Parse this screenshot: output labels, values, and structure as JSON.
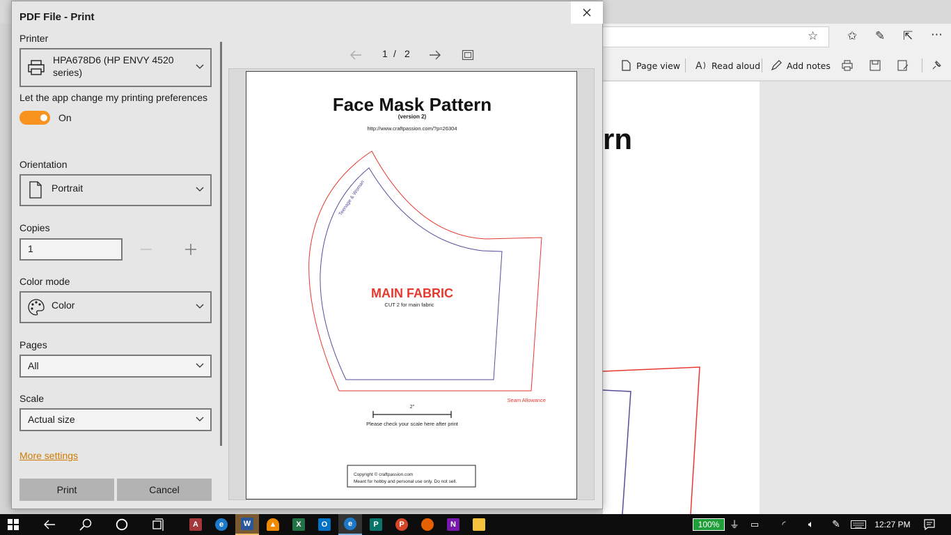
{
  "dialog": {
    "title": "PDF File - Print"
  },
  "printer": {
    "label": "Printer",
    "value_line1": "HPA678D6 (HP ENVY 4520",
    "value_line2": "series)"
  },
  "preferences": {
    "label": "Let the app change my printing preferences",
    "toggle_state": "On",
    "toggle_on": true
  },
  "orientation": {
    "label": "Orientation",
    "value": "Portrait"
  },
  "copies": {
    "label": "Copies",
    "value": "1"
  },
  "color_mode": {
    "label": "Color mode",
    "value": "Color"
  },
  "pages": {
    "label": "Pages",
    "value": "All"
  },
  "scale": {
    "label": "Scale",
    "value": "Actual size"
  },
  "more_settings": "More settings",
  "buttons": {
    "print": "Print",
    "cancel": "Cancel"
  },
  "preview": {
    "current_page": "1",
    "separator": "/",
    "total_pages": "2",
    "document": {
      "title": "Face Mask Pattern",
      "version": "(version 2)",
      "url": "http://www.craftpassion.com/?p=26304",
      "size_label": "Teenage & Woman",
      "fabric_title": "MAIN FABRIC",
      "fabric_note": "CUT 2 for main fabric",
      "seam_label": "Seam Allowance",
      "scale_label": "2\"",
      "scale_note": "Please check your scale here after print",
      "copyright_line1": "Copyright © craftpassion.com",
      "copyright_line2": "Meant for hobby and personal use only. Do not sell."
    }
  },
  "browser": {
    "toolbar": {
      "page_view": "Page view",
      "read_aloud": "Read aloud",
      "add_notes": "Add notes"
    },
    "heading_fragment": "rn"
  },
  "taskbar": {
    "battery": "100%",
    "time": "12:27 PM",
    "apps": [
      "start-icon",
      "back-icon",
      "search-icon",
      "cortana-icon",
      "task-view-icon",
      "access-icon",
      "ie-icon",
      "word-icon",
      "vlc-icon",
      "excel-icon",
      "outlook-icon",
      "edge-icon",
      "publisher-icon",
      "powerpoint-icon",
      "firefox-icon",
      "onenote-icon",
      "file-explorer-icon"
    ]
  },
  "colors": {
    "accent_orange": "#f7931e",
    "link_orange": "#d07a00",
    "pattern_red": "#e8382f",
    "pattern_purple": "#5b4a9a",
    "battery_green": "#1f9e3a"
  }
}
